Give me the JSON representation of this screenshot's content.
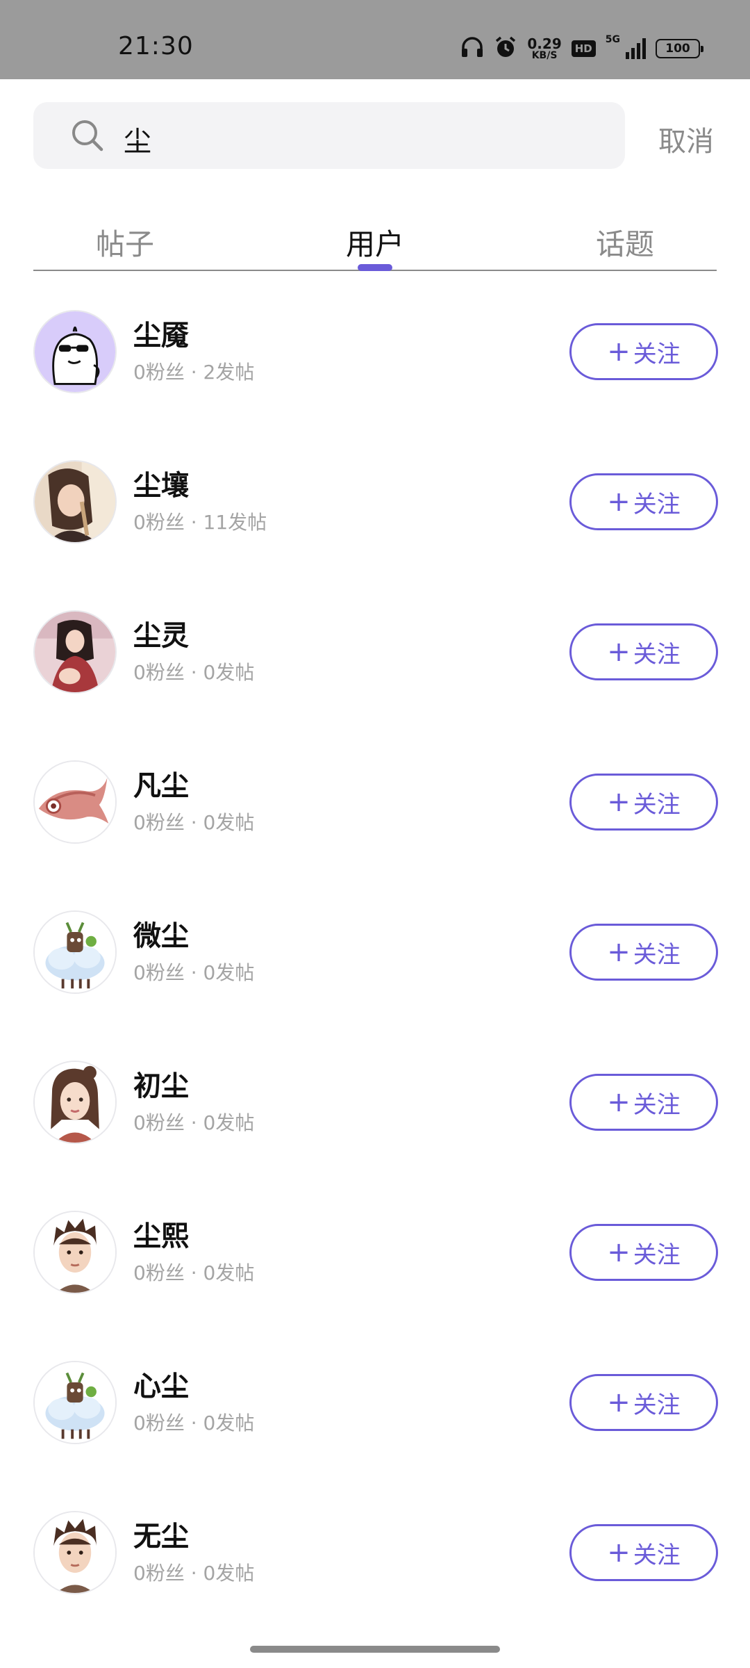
{
  "status_bar": {
    "time": "21:30",
    "net_speed_value": "0.29",
    "net_speed_unit": "KB/S",
    "hd": "HD",
    "network": "5G",
    "battery": "100",
    "icons": [
      "headphones-icon",
      "alarm-icon",
      "signal-icon",
      "battery-icon"
    ]
  },
  "search": {
    "query": "尘",
    "cancel_label": "取消"
  },
  "tabs": [
    {
      "label": "帖子",
      "active": false
    },
    {
      "label": "用户",
      "active": true
    },
    {
      "label": "话题",
      "active": false
    }
  ],
  "accent_color": "#6a5bd9",
  "users": [
    {
      "name": "尘魇",
      "meta": "0粉丝 · 2发帖",
      "follow_label": "关注",
      "avatar": "cartoon-face"
    },
    {
      "name": "尘壤",
      "meta": "0粉丝 · 11发帖",
      "follow_label": "关注",
      "avatar": "anime-girl"
    },
    {
      "name": "尘灵",
      "meta": "0粉丝 · 0发帖",
      "follow_label": "关注",
      "avatar": "girl-photo"
    },
    {
      "name": "凡尘",
      "meta": "0粉丝 · 0发帖",
      "follow_label": "关注",
      "avatar": "fish"
    },
    {
      "name": "微尘",
      "meta": "0粉丝 · 0发帖",
      "follow_label": "关注",
      "avatar": "cloud-creature"
    },
    {
      "name": "初尘",
      "meta": "0粉丝 · 0发帖",
      "follow_label": "关注",
      "avatar": "female-3d"
    },
    {
      "name": "尘熙",
      "meta": "0粉丝 · 0发帖",
      "follow_label": "关注",
      "avatar": "male-3d"
    },
    {
      "name": "心尘",
      "meta": "0粉丝 · 0发帖",
      "follow_label": "关注",
      "avatar": "cloud-creature"
    },
    {
      "name": "无尘",
      "meta": "0粉丝 · 0发帖",
      "follow_label": "关注",
      "avatar": "male-3d"
    }
  ]
}
